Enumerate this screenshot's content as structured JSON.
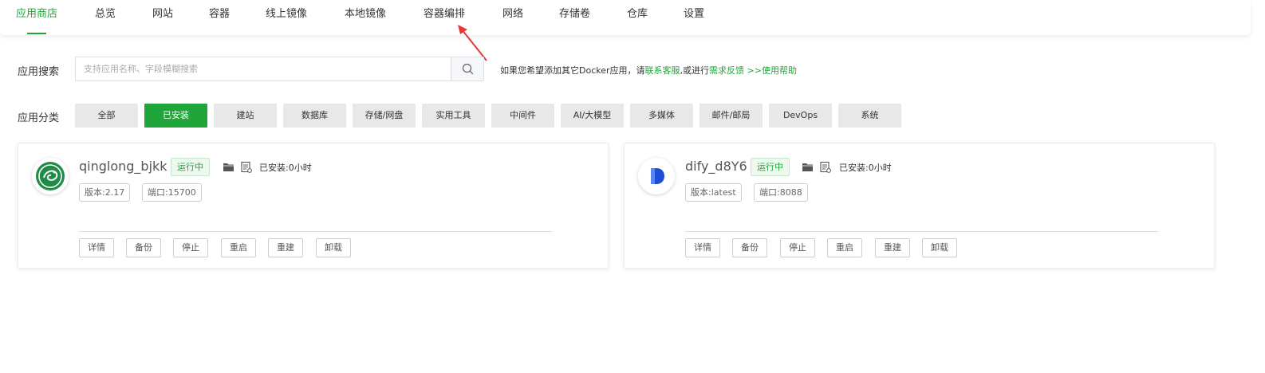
{
  "nav": {
    "tabs": [
      {
        "label": "应用商店",
        "active": true
      },
      {
        "label": "总览"
      },
      {
        "label": "网站"
      },
      {
        "label": "容器"
      },
      {
        "label": "线上镜像"
      },
      {
        "label": "本地镜像"
      },
      {
        "label": "容器编排"
      },
      {
        "label": "网络"
      },
      {
        "label": "存储卷"
      },
      {
        "label": "仓库"
      },
      {
        "label": "设置"
      }
    ]
  },
  "search": {
    "label": "应用搜索",
    "placeholder": "支持应用名称、字段模糊搜索",
    "value": "",
    "hint_prefix": "如果您希望添加其它Docker应用，请",
    "hint_link1": "联系客服",
    "hint_middle": ",或进行",
    "hint_link2": "需求反馈",
    "hint_link3": ">>使用帮助"
  },
  "category": {
    "label": "应用分类",
    "items": [
      {
        "label": "全部"
      },
      {
        "label": "已安装",
        "active": true
      },
      {
        "label": "建站"
      },
      {
        "label": "数据库"
      },
      {
        "label": "存储/网盘"
      },
      {
        "label": "实用工具"
      },
      {
        "label": "中间件"
      },
      {
        "label": "AI/大模型"
      },
      {
        "label": "多媒体"
      },
      {
        "label": "邮件/邮局"
      },
      {
        "label": "DevOps"
      },
      {
        "label": "系统"
      }
    ]
  },
  "apps": [
    {
      "name": "qinglong_bjkk",
      "status": "运行中",
      "installed": "已安装:0小时",
      "version": "版本:2.17",
      "port": "端口:15700",
      "logo_icon": "qinglong-logo-icon",
      "actions": [
        "详情",
        "备份",
        "停止",
        "重启",
        "重建",
        "卸载"
      ]
    },
    {
      "name": "dify_d8Y6",
      "status": "运行中",
      "installed": "已安装:0小时",
      "version": "版本:latest",
      "port": "端口:8088",
      "logo_icon": "dify-logo-icon",
      "actions": [
        "详情",
        "备份",
        "停止",
        "重启",
        "重建",
        "卸载"
      ]
    }
  ],
  "colors": {
    "accent": "#20a53a",
    "chip_bg": "#e8e8e8",
    "annotation_arrow": "#e53935"
  }
}
